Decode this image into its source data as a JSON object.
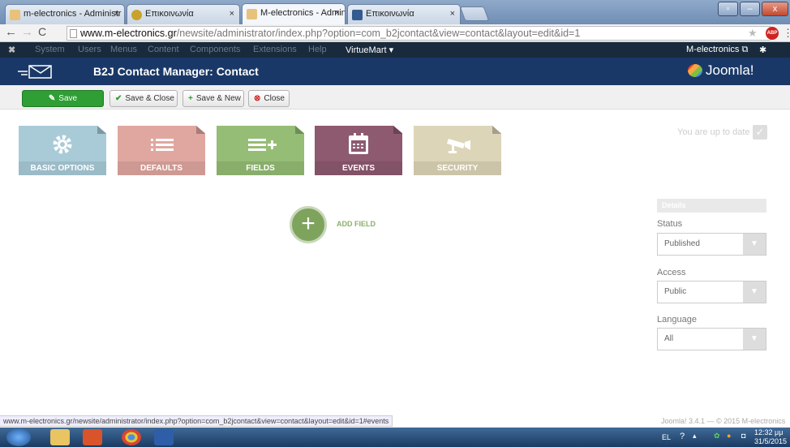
{
  "browser": {
    "tabs": [
      {
        "title": "m-electronics - Administr",
        "active": false
      },
      {
        "title": "Επικοινωνία",
        "active": false
      },
      {
        "title": "M-electronics - Administr",
        "active": true
      },
      {
        "title": "Επικοινωνία",
        "active": false
      }
    ],
    "tab_close": "×",
    "url_host": "www.m-electronics.gr",
    "url_path": "/newsite/administrator/index.php?option=com_b2jcontact&view=contact&layout=edit&id=1",
    "abp_label": "ABP"
  },
  "admin_menu": {
    "items": [
      "System",
      "Users",
      "Menus",
      "Content",
      "Components",
      "Extensions",
      "Help"
    ],
    "virtuemart": "VirtueMart",
    "site_name": "M-electronics"
  },
  "header": {
    "title": "B2J Contact Manager: Contact",
    "logo_text": "Joomla!"
  },
  "toolbar": {
    "save": "Save",
    "save_close": "Save & Close",
    "save_new": "Save & New",
    "close": "Close"
  },
  "cards": [
    {
      "label": "BASIC OPTIONS",
      "icon": "gear-icon",
      "color": "#a9cbd8"
    },
    {
      "label": "DEFAULTS",
      "icon": "list-icon",
      "color": "#e0a7a0"
    },
    {
      "label": "FIELDS",
      "icon": "list-add-icon",
      "color": "#95bd76"
    },
    {
      "label": "EVENTS",
      "icon": "calendar-icon",
      "color": "#8e5a70"
    },
    {
      "label": "SECURITY",
      "icon": "camera-icon",
      "color": "#ddd5b8"
    }
  ],
  "update_status": "You are up to date",
  "add_field": "ADD FIELD",
  "details": {
    "heading": "Details",
    "status_label": "Status",
    "status_value": "Published",
    "access_label": "Access",
    "access_value": "Public",
    "language_label": "Language",
    "language_value": "All"
  },
  "status_bar_url": "www.m-electronics.gr/newsite/administrator/index.php?option=com_b2jcontact&view=contact&layout=edit&id=1#events",
  "footer": "Joomla! 3.4.1 — © 2015 M-electronics",
  "taskbar": {
    "lang": "EL",
    "time": "12:32 μμ",
    "date": "31/5/2015"
  }
}
